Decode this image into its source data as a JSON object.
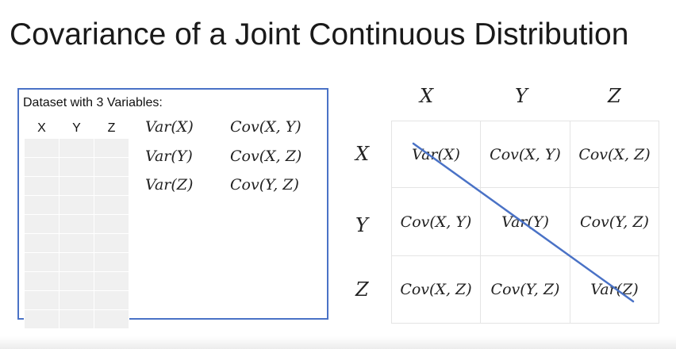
{
  "title": "Covariance of a Joint Continuous Distribution",
  "dataset": {
    "heading": "Dataset with 3 Variables:",
    "columns": [
      "X",
      "Y",
      "Z"
    ],
    "empty_rows": 10,
    "variances": [
      "Var(X)",
      "Var(Y)",
      "Var(Z)"
    ],
    "covariances": [
      "Cov(X, Y)",
      "Cov(X, Z)",
      "Cov(Y, Z)"
    ]
  },
  "matrix": {
    "column_headers": [
      "X",
      "Y",
      "Z"
    ],
    "row_headers": [
      "X",
      "Y",
      "Z"
    ],
    "cells": [
      [
        "Var(X)",
        "Cov(X, Y)",
        "Cov(X, Z)"
      ],
      [
        "Cov(X, Y)",
        "Var(Y)",
        "Cov(Y, Z)"
      ],
      [
        "Cov(X, Z)",
        "Cov(Y, Z)",
        "Var(Z)"
      ]
    ]
  },
  "colors": {
    "accent": "#4a72c6",
    "text": "#222222",
    "grid_fill": "#f0f0f0"
  }
}
